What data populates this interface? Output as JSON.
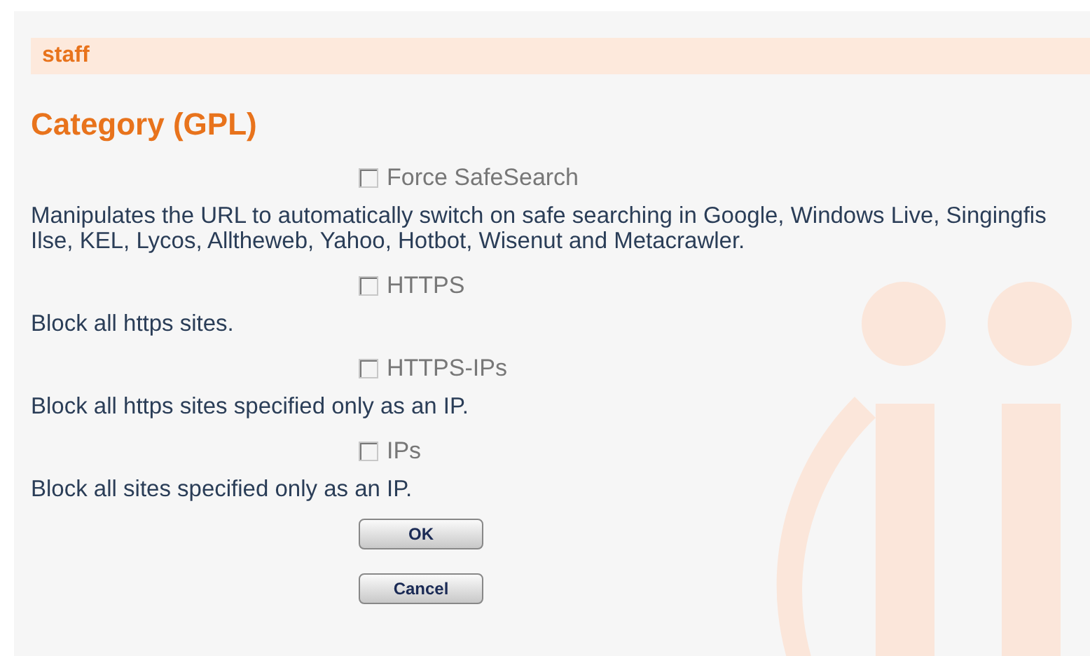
{
  "header": "staff",
  "title": "Category (GPL)",
  "options": [
    {
      "label": "Force SafeSearch",
      "checked": false,
      "disabled": true,
      "description": [
        "Manipulates the URL to automatically switch on safe searching in Google, Windows Live, Singingfis",
        "Ilse, KEL, Lycos, Alltheweb, Yahoo, Hotbot, Wisenut and Metacrawler."
      ]
    },
    {
      "label": "HTTPS",
      "checked": false,
      "disabled": true,
      "description": [
        "Block all https sites."
      ]
    },
    {
      "label": "HTTPS-IPs",
      "checked": false,
      "disabled": true,
      "description": [
        "Block all https sites specified only as an IP."
      ]
    },
    {
      "label": "IPs",
      "checked": false,
      "disabled": true,
      "description": [
        "Block all sites specified only as an IP."
      ]
    }
  ],
  "buttons": [
    "OK",
    "Cancel"
  ]
}
